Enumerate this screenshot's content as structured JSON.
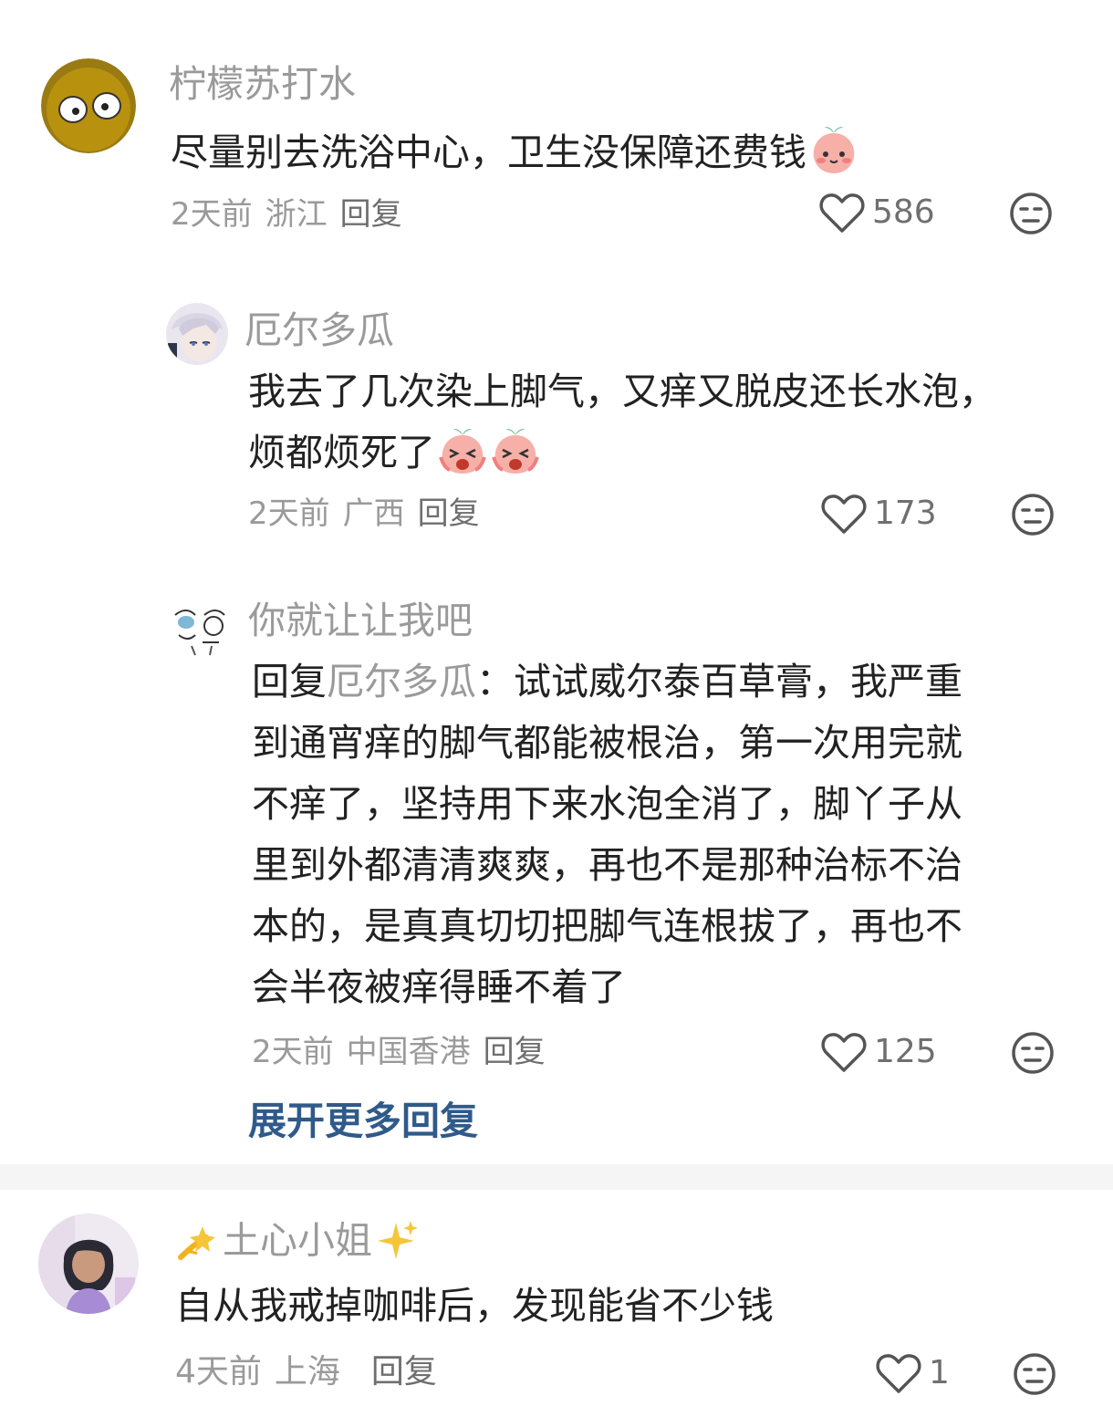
{
  "comments": [
    {
      "username": "柠檬苏打水",
      "content": "尽量别去洗浴中心，卫生没保障还费钱",
      "time": "2天前",
      "location": "浙江",
      "reply_label": "回复",
      "likes": "586",
      "avatar_icon": "plant-zombie-avatar",
      "emoji": "peach-smile-emoji"
    },
    {
      "username": "厄尔多瓜",
      "content_line1": "我去了几次染上脚气，又痒又脱皮还长水泡，",
      "content_line2": "烦都烦死了",
      "time": "2天前",
      "location": "广西",
      "reply_label": "回复",
      "likes": "173",
      "avatar_icon": "anime-white-hair-avatar",
      "emoji": "peach-crying-emoji"
    },
    {
      "username": "你就让让我吧",
      "reply_prefix": "回复",
      "mention": "厄尔多瓜",
      "content_lines": [
        "：试试威尔泰百草膏，我严重",
        "到通宵痒的脚气都能被根治，第一次用完就",
        "不痒了，坚持用下来水泡全消了，脚丫子从",
        "里到外都清清爽爽，再也不是那种治标不治",
        "本的，是真真切切把脚气连根拔了，再也不",
        "会半夜被痒得睡不着了"
      ],
      "time": "2天前",
      "location": "中国香港",
      "reply_label": "回复",
      "likes": "125",
      "avatar_icon": "sketch-cartoon-avatar"
    },
    {
      "username": "土心小姐",
      "content": "自从我戒掉咖啡后，发现能省不少钱",
      "time": "4天前",
      "location": "上海",
      "reply_label": "回复",
      "likes": "1",
      "avatar_icon": "girl-illustration-avatar",
      "name_deco_left": "dizzy-icon",
      "name_deco_right": "sparkles-icon"
    }
  ],
  "expand_replies": "展开更多回复",
  "icons": {
    "like": "heart-icon",
    "dislike": "meh-face-icon"
  },
  "colors": {
    "link": "#2f5a8a",
    "meta": "#9a9a9a",
    "text": "#222222"
  }
}
